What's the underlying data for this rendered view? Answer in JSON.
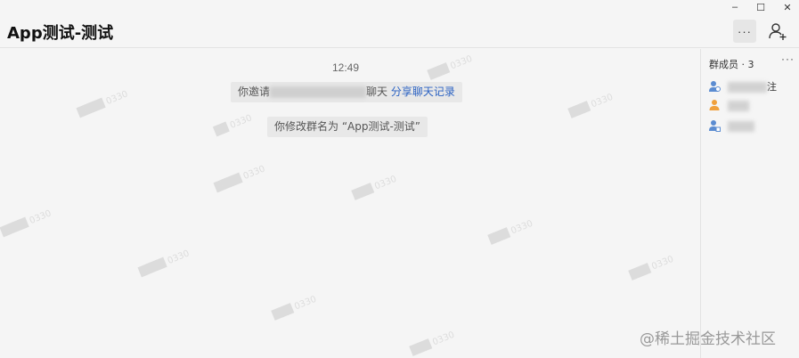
{
  "window": {
    "minimize_glyph": "–",
    "maximize_glyph": "☐",
    "close_glyph": "✕"
  },
  "header": {
    "title": "App测试-测试",
    "more_glyph": "···"
  },
  "chat": {
    "timestamp": "12:49",
    "messages": [
      {
        "prefix": "你邀请",
        "suffix": "聊天",
        "link": "分享聊天记录"
      },
      {
        "text": "你修改群名为 “App测试-测试”"
      }
    ]
  },
  "sidebar": {
    "title": "群成员 · 3",
    "more_glyph": "···",
    "members": [
      {
        "name_suffix": "注",
        "icon": "member-admin-icon",
        "color": "#5b8cd1"
      },
      {
        "name_suffix": "",
        "icon": "member-user-icon",
        "color": "#f0a03c"
      },
      {
        "name_suffix": "",
        "icon": "member-user-icon",
        "color": "#5b8cd1"
      }
    ]
  },
  "site_watermark": "@稀土掘金技术社区",
  "colors": {
    "link": "#2b62c2",
    "background": "#f5f5f5"
  }
}
